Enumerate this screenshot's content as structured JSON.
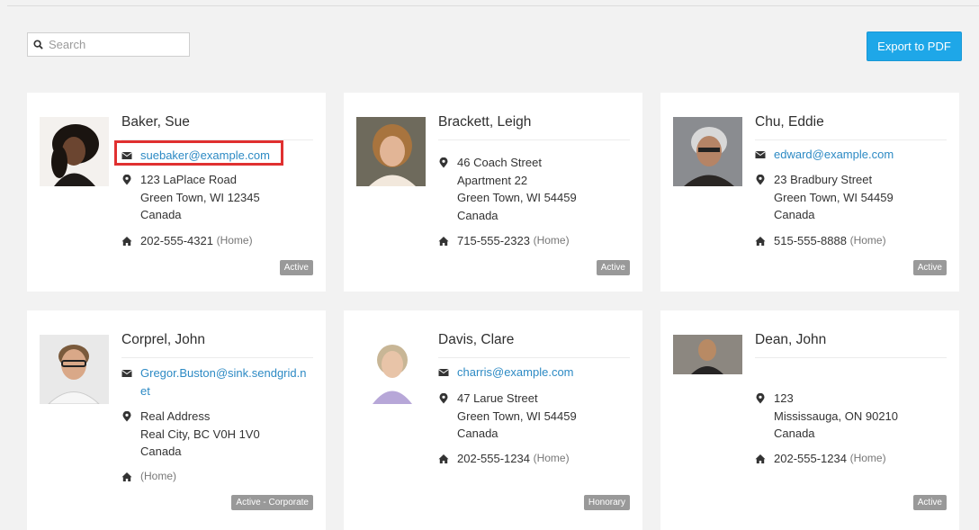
{
  "search": {
    "placeholder": "Search",
    "value": ""
  },
  "toolbar": {
    "export_label": "Export to PDF"
  },
  "contacts": [
    {
      "name": "Baker, Sue",
      "email": "suebaker@example.com",
      "address": [
        "123 LaPlace Road",
        "Green Town, WI 12345",
        "Canada"
      ],
      "phone": "202-555-4321",
      "phone_type": "(Home)",
      "status": "Active"
    },
    {
      "name": "Brackett, Leigh",
      "email": "",
      "address": [
        "46 Coach Street",
        "Apartment 22",
        "Green Town, WI 54459",
        "Canada"
      ],
      "phone": "715-555-2323",
      "phone_type": "(Home)",
      "status": "Active"
    },
    {
      "name": "Chu, Eddie",
      "email": "edward@example.com",
      "address": [
        "23 Bradbury Street",
        "Green Town, WI 54459",
        "Canada"
      ],
      "phone": "515-555-8888",
      "phone_type": "(Home)",
      "status": "Active"
    },
    {
      "name": "Corprel, John",
      "email_lines": [
        "Gregor.Buston@sink.sendgrid.n",
        "et"
      ],
      "address": [
        "Real Address",
        "Real City, BC V0H 1V0",
        "Canada"
      ],
      "phone": "",
      "phone_type": "(Home)",
      "status": "Active - Corporate"
    },
    {
      "name": "Davis, Clare",
      "email": "charris@example.com",
      "address": [
        "47 Larue Street",
        "Green Town, WI 54459",
        "Canada"
      ],
      "phone": "202-555-1234",
      "phone_type": "(Home)",
      "status": "Honorary"
    },
    {
      "name": "Dean, John",
      "email": "",
      "address": [
        "123",
        "Mississauga, ON 90210",
        "Canada"
      ],
      "phone": "202-555-1234",
      "phone_type": "(Home)",
      "status": "Active"
    }
  ],
  "colors": {
    "accent": "#1ea7e8",
    "link": "#2d8ac4",
    "badge": "#999999",
    "highlight": "#e03030"
  },
  "icons": {
    "search": "search-icon",
    "email": "envelope-icon",
    "address": "map-marker-icon",
    "phone": "home-icon"
  }
}
